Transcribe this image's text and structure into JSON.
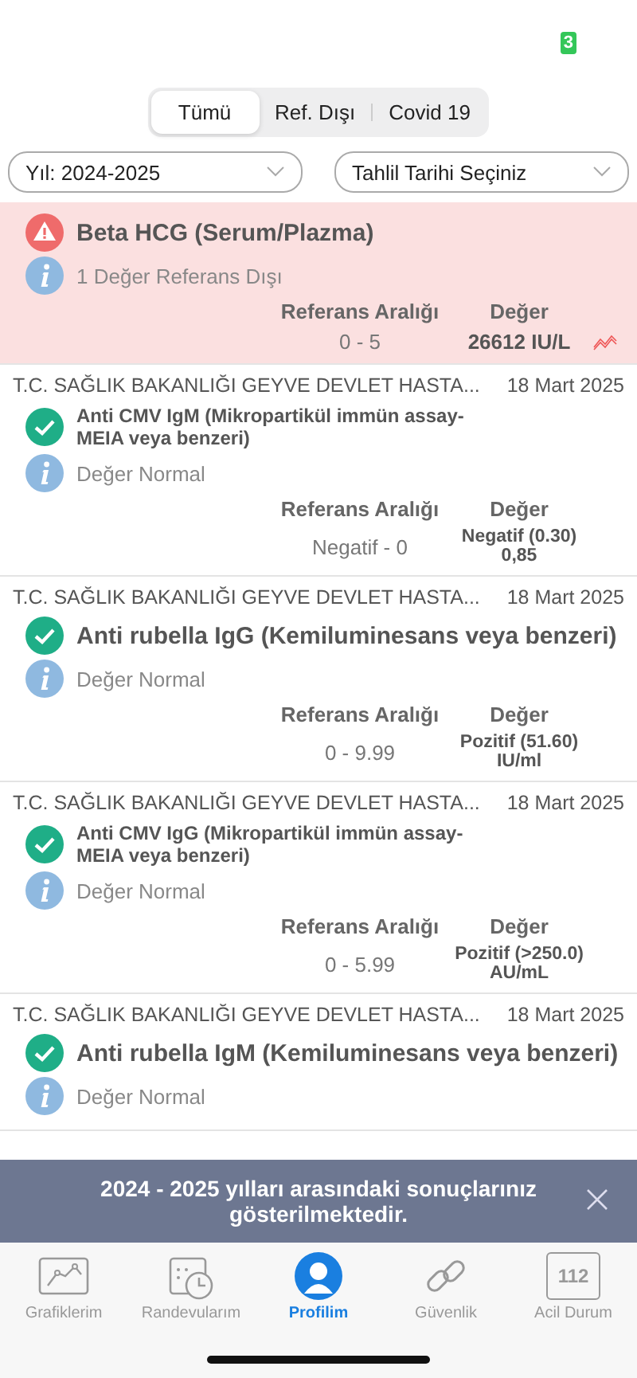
{
  "status_bar": {
    "badge": "3"
  },
  "segments": [
    {
      "label": "Tümü",
      "selected": true
    },
    {
      "label": "Ref. Dışı",
      "selected": false
    },
    {
      "label": "Covid 19",
      "selected": false
    }
  ],
  "filters": [
    {
      "value": "Yıl: 2024-2025"
    },
    {
      "value": "Tahlil Tarihi Seçiniz"
    }
  ],
  "results": [
    {
      "kind": "warning",
      "out_of_range": true,
      "title": "Beta HCG (Serum/Plazma)",
      "info": "1 Değer Referans Dışı",
      "range_label": "Referans Aralığı",
      "value_label": "Değer",
      "range": "0 - 5",
      "value": "26612 IU/L"
    },
    {
      "kind": "ok",
      "out_of_range": false,
      "source": "T.C. SAĞLIK BAKANLIĞI GEYVE DEVLET HASTA...",
      "date": "18 Mart 2025",
      "title": "Anti CMV IgM (Mikropartikül immün assay-MEIA veya benzeri)",
      "info": "Değer Normal",
      "range_label": "Referans Aralığı",
      "value_label": "Değer",
      "range": "Negatif - 0",
      "value": "Negatif (0.30) 0,85"
    },
    {
      "kind": "ok",
      "out_of_range": false,
      "source": "T.C. SAĞLIK BAKANLIĞI GEYVE DEVLET HASTA...",
      "date": "18 Mart 2025",
      "title": "Anti rubella IgG (Kemiluminesans veya benzeri)",
      "info": "Değer Normal",
      "range_label": "Referans Aralığı",
      "value_label": "Değer",
      "range": "0 - 9.99",
      "value": "Pozitif (51.60) IU/ml"
    },
    {
      "kind": "ok",
      "out_of_range": false,
      "source": "T.C. SAĞLIK BAKANLIĞI GEYVE DEVLET HASTA...",
      "date": "18 Mart 2025",
      "title": "Anti CMV IgG (Mikropartikül immün assay-MEIA veya benzeri)",
      "info": "Değer Normal",
      "range_label": "Referans Aralığı",
      "value_label": "Değer",
      "range": "0 - 5.99",
      "value": "Pozitif (>250.0) AU/mL"
    },
    {
      "kind": "ok",
      "out_of_range": false,
      "source": "T.C. SAĞLIK BAKANLIĞI GEYVE DEVLET HASTA...",
      "date": "18 Mart 2025",
      "title": "Anti rubella IgM (Kemiluminesans veya benzeri)",
      "info": "Değer Normal"
    }
  ],
  "banner": {
    "text": "2024 - 2025 yılları arasındaki sonuçlarınız gösterilmektedir."
  },
  "tab_bar": [
    {
      "label": "Grafiklerim",
      "selected": false
    },
    {
      "label": "Randevularım",
      "selected": false
    },
    {
      "label": "Profilim",
      "selected": true
    },
    {
      "label": "Güvenlik",
      "selected": false
    },
    {
      "label": "Acil Durum",
      "selected": false,
      "icon_text": "112"
    }
  ]
}
